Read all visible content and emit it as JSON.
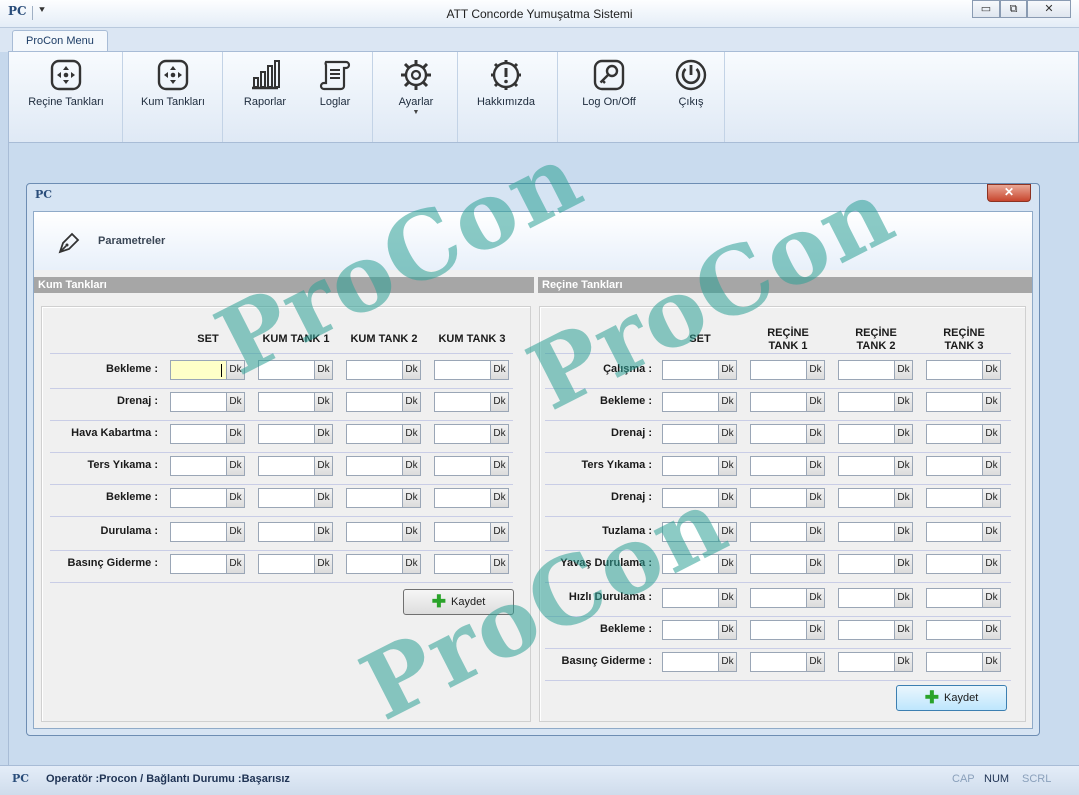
{
  "window": {
    "title": "ATT Concorde Yumuşatma Sistemi",
    "app_icon": "PC",
    "minimize": "▭",
    "maximize": "⧉",
    "close": "✕",
    "quick_access": "⯆"
  },
  "ribbon": {
    "tab_label": "ProCon Menu",
    "buttons": [
      {
        "label": "Reçine Tankları",
        "icon": "tank-icon"
      },
      {
        "label": "Kum Tankları",
        "icon": "tank-icon"
      },
      {
        "label": "Raporlar",
        "icon": "bar-chart-icon"
      },
      {
        "label": "Loglar",
        "icon": "scroll-icon"
      },
      {
        "label": "Ayarlar",
        "icon": "gear-icon"
      },
      {
        "label": "Hakkımızda",
        "icon": "info-gear-icon"
      },
      {
        "label": "Log On/Off",
        "icon": "key-icon"
      },
      {
        "label": "Çıkış",
        "icon": "power-icon"
      }
    ]
  },
  "child_window": {
    "icon": "PC",
    "close": "✕",
    "header_title": "Parametreler"
  },
  "kum": {
    "section_title": "Kum Tankları",
    "columns": [
      "SET",
      "KUM TANK 1",
      "KUM TANK 2",
      "KUM TANK 3"
    ],
    "rows": [
      "Bekleme :",
      "Drenaj :",
      "Hava Kabartma :",
      "Ters Yıkama :",
      "Bekleme :",
      "Durulama :",
      "Basınç Giderme :"
    ],
    "unit": "Dk",
    "save_label": "Kaydet"
  },
  "recine": {
    "section_title": "Reçine Tankları",
    "columns": [
      "SET",
      "REÇİNE\nTANK 1",
      "REÇİNE\nTANK 2",
      "REÇİNE\nTANK 3"
    ],
    "rows": [
      "Çalışma :",
      "Bekleme :",
      "Drenaj :",
      "Ters Yıkama :",
      "Drenaj :",
      "Tuzlama :",
      "Yavaş Durulama :",
      "Hızlı Durulama :",
      "Bekleme :",
      "Basınç Giderme :"
    ],
    "unit": "Dk",
    "save_label": "Kaydet"
  },
  "status": {
    "icon": "PC",
    "text": "Operatör :Procon / Bağlantı Durumu :Başarısız",
    "caps": "CAP",
    "num": "NUM",
    "scrl": "SCRL"
  },
  "watermark": "ProCon"
}
